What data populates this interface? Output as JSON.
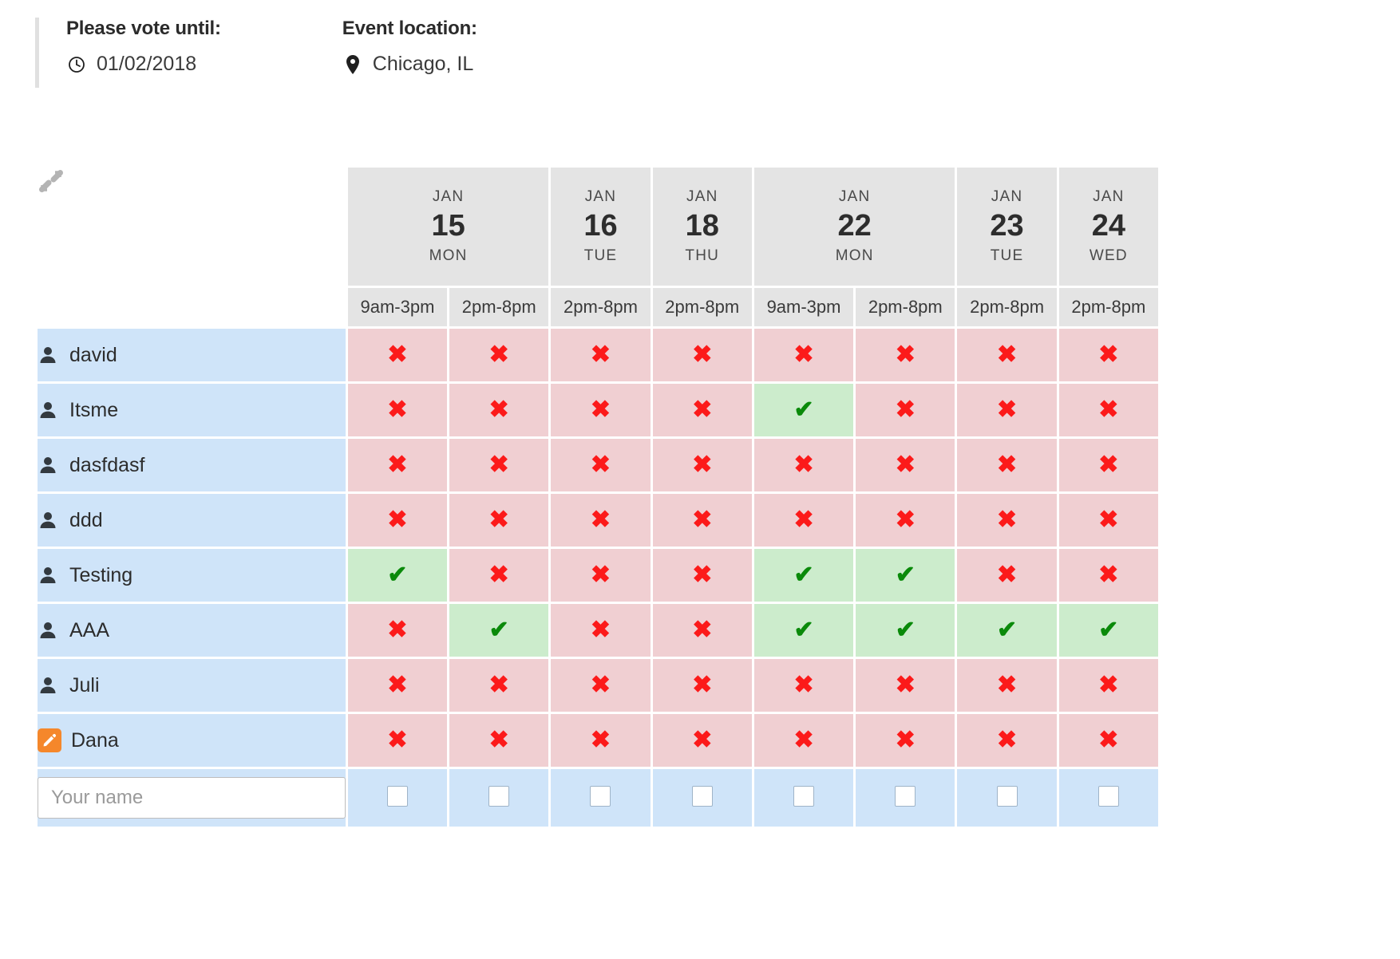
{
  "header": {
    "deadline": {
      "label": "Please vote until:",
      "icon": "clock-icon",
      "value": "01/02/2018"
    },
    "location": {
      "label": "Event location:",
      "icon": "map-pin-icon",
      "value": "Chicago, IL"
    }
  },
  "table": {
    "collapse_icon": "collapse-arrows-icon",
    "dates": [
      {
        "month": "JAN",
        "day": "15",
        "dow": "MON",
        "span": 2
      },
      {
        "month": "JAN",
        "day": "16",
        "dow": "TUE",
        "span": 1
      },
      {
        "month": "JAN",
        "day": "18",
        "dow": "THU",
        "span": 1
      },
      {
        "month": "JAN",
        "day": "22",
        "dow": "MON",
        "span": 2
      },
      {
        "month": "JAN",
        "day": "23",
        "dow": "TUE",
        "span": 1
      },
      {
        "month": "JAN",
        "day": "24",
        "dow": "WED",
        "span": 1
      }
    ],
    "slots": [
      "9am-3pm",
      "2pm-8pm",
      "2pm-8pm",
      "2pm-8pm",
      "9am-3pm",
      "2pm-8pm",
      "2pm-8pm",
      "2pm-8pm"
    ],
    "yes_mark": "✔",
    "no_mark": "✖",
    "participants": [
      {
        "name": "david",
        "icon": "person-icon",
        "votes": [
          "no",
          "no",
          "no",
          "no",
          "no",
          "no",
          "no",
          "no"
        ]
      },
      {
        "name": "Itsme",
        "icon": "person-icon",
        "votes": [
          "no",
          "no",
          "no",
          "no",
          "yes",
          "no",
          "no",
          "no"
        ]
      },
      {
        "name": "dasfdasf",
        "icon": "person-icon",
        "votes": [
          "no",
          "no",
          "no",
          "no",
          "no",
          "no",
          "no",
          "no"
        ]
      },
      {
        "name": "ddd",
        "icon": "person-icon",
        "votes": [
          "no",
          "no",
          "no",
          "no",
          "no",
          "no",
          "no",
          "no"
        ]
      },
      {
        "name": "Testing",
        "icon": "person-icon",
        "votes": [
          "yes",
          "no",
          "no",
          "no",
          "yes",
          "yes",
          "no",
          "no"
        ]
      },
      {
        "name": "AAA",
        "icon": "person-icon",
        "votes": [
          "no",
          "yes",
          "no",
          "no",
          "yes",
          "yes",
          "yes",
          "yes"
        ]
      },
      {
        "name": "Juli",
        "icon": "person-icon",
        "votes": [
          "no",
          "no",
          "no",
          "no",
          "no",
          "no",
          "no",
          "no"
        ]
      },
      {
        "name": "Dana",
        "icon": "edit-pencil-icon",
        "votes": [
          "no",
          "no",
          "no",
          "no",
          "no",
          "no",
          "no",
          "no"
        ]
      }
    ],
    "vote_row": {
      "name_placeholder": "Your name",
      "name_value": "",
      "checkbox_count": 8
    }
  },
  "colors": {
    "yes_bg": "#cceccc",
    "yes_fg": "#0a8a0a",
    "no_bg": "#f0cfd2",
    "no_fg": "#fc1a1a",
    "name_bg": "#cfe4f9",
    "head_bg": "#e4e4e4",
    "edit_icon_bg": "#f5872b"
  }
}
